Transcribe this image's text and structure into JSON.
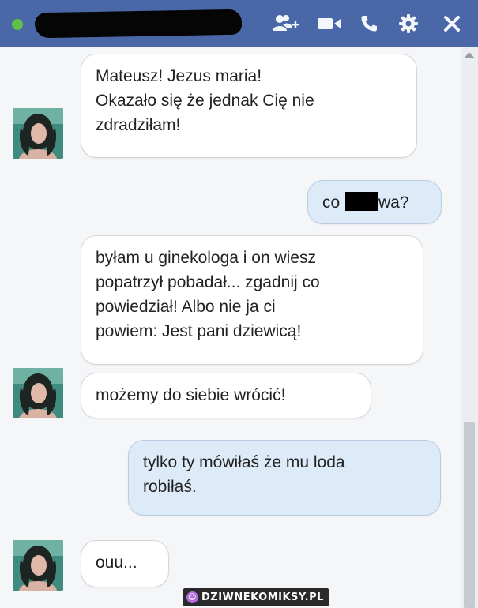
{
  "header": {
    "icons": [
      "add-people-icon",
      "video-call-icon",
      "phone-call-icon",
      "settings-gear-icon",
      "close-icon"
    ],
    "colors": {
      "bar": "#4a67a8",
      "online": "#5fbf47"
    }
  },
  "messages": [
    {
      "from": "them",
      "text": "Mateusz! Jezus maria!\nOkazało się że jednak Cię nie\nzdradziłam!"
    },
    {
      "from": "me",
      "text_before": "co ",
      "text_after": "wa?"
    },
    {
      "from": "them",
      "text": "byłam u ginekologa i on wiesz\npopatrzył pobadał... zgadnij co\npowiedział! Albo nie ja ci\npowiem: Jest pani dziewicą!"
    },
    {
      "from": "them",
      "text": "możemy do siebie wrócić!"
    },
    {
      "from": "me",
      "text": "tylko ty mówiłaś że mu loda\nrobiłaś."
    },
    {
      "from": "them",
      "text": "ouu..."
    }
  ],
  "watermark": {
    "text": "DZIWNEKOMIKSY.PL",
    "icon": "monster-logo-icon"
  },
  "colors": {
    "incoming": "#ffffff",
    "outgoing": "#ddeaf8",
    "background": "#f5f6f8"
  }
}
